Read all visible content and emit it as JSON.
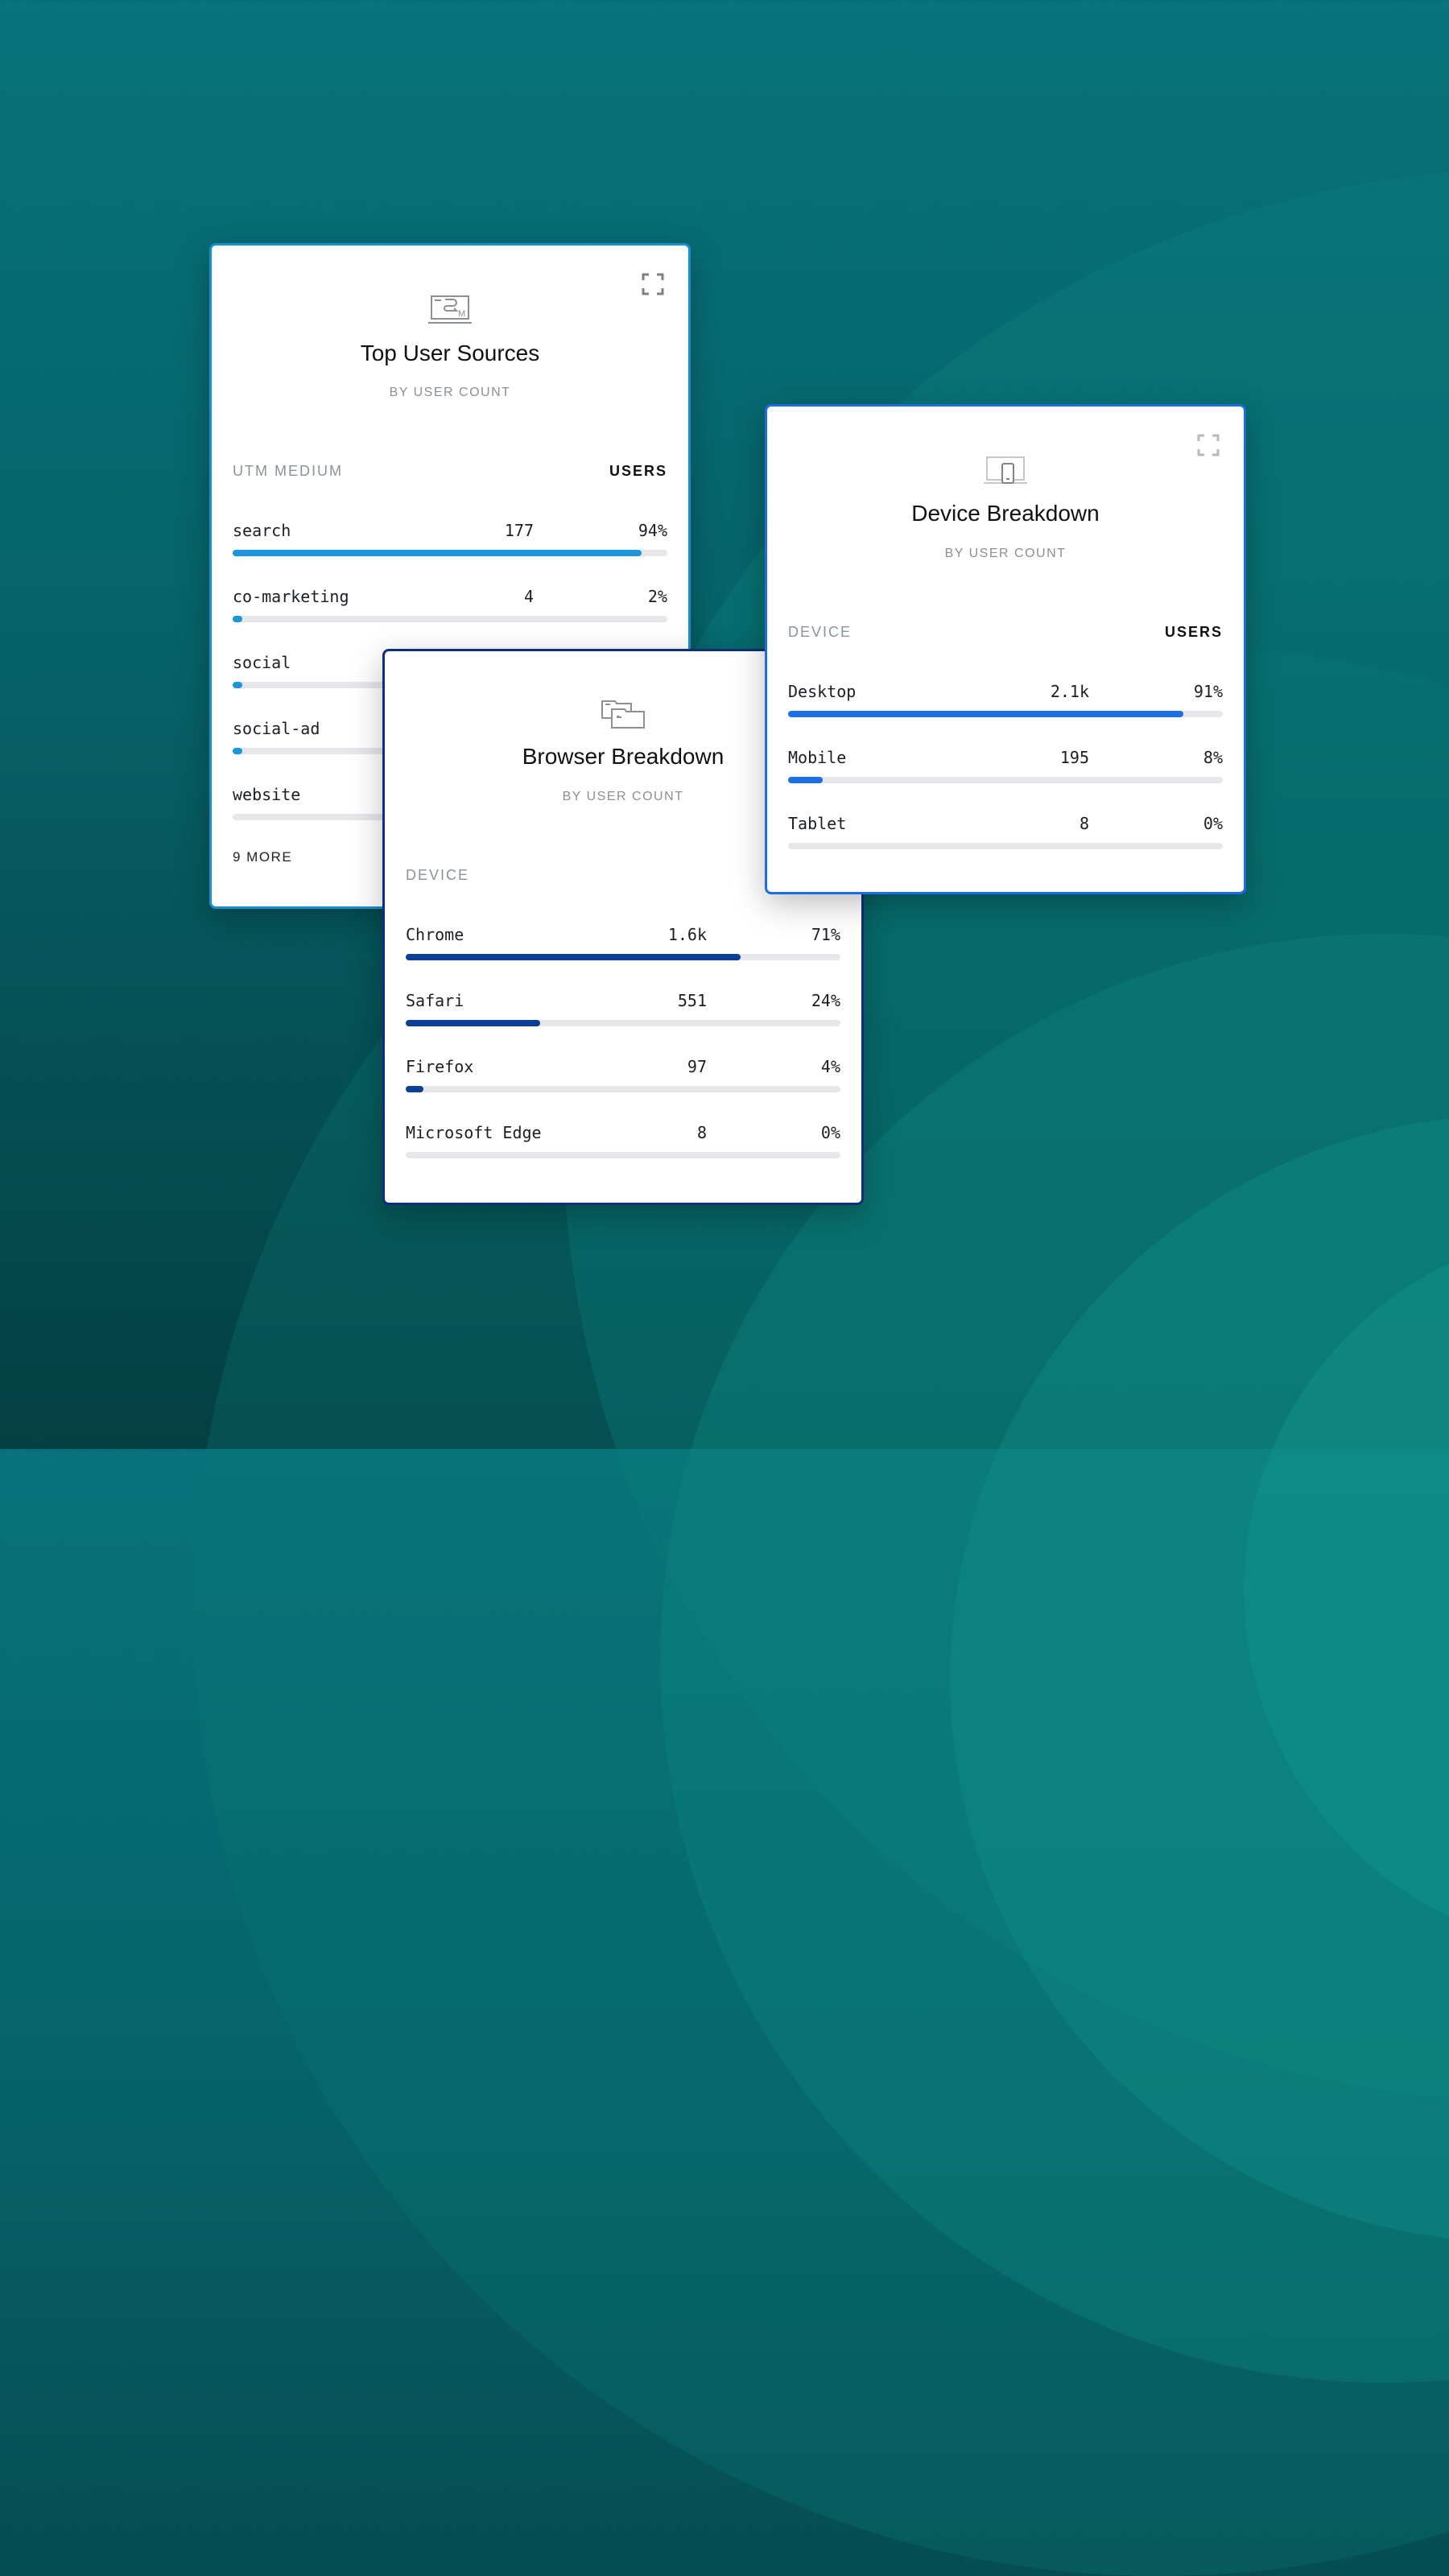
{
  "colors": {
    "sources_accent": "#1a96dc",
    "browser_accent": "#0d3f96",
    "device_accent": "#1d6fe6"
  },
  "cards": {
    "sources": {
      "icon": "utm-laptop-icon",
      "title": "Top User Sources",
      "subtitle": "BY USER COUNT",
      "col_left": "UTM MEDIUM",
      "col_right": "USERS",
      "rows": [
        {
          "name": "search",
          "count": "177",
          "pct": "94%",
          "fraction": 0.94
        },
        {
          "name": "co-marketing",
          "count": "4",
          "pct": "2%",
          "fraction": 0.02
        },
        {
          "name": "social",
          "count": "",
          "pct": "",
          "fraction": 0.01
        },
        {
          "name": "social-ad",
          "count": "",
          "pct": "",
          "fraction": 0.01
        },
        {
          "name": "website",
          "count": "",
          "pct": "",
          "fraction": 0
        }
      ],
      "more_label": "9 MORE"
    },
    "browser": {
      "icon": "browser-windows-icon",
      "title": "Browser Breakdown",
      "subtitle": "BY USER COUNT",
      "col_left": "DEVICE",
      "col_right": "",
      "rows": [
        {
          "name": "Chrome",
          "count": "1.6k",
          "pct": "71%",
          "fraction": 0.77
        },
        {
          "name": "Safari",
          "count": "551",
          "pct": "24%",
          "fraction": 0.31
        },
        {
          "name": "Firefox",
          "count": "97",
          "pct": "4%",
          "fraction": 0.04
        },
        {
          "name": "Microsoft Edge",
          "count": "8",
          "pct": "0%",
          "fraction": 0
        }
      ]
    },
    "device": {
      "icon": "device-laptop-phone-icon",
      "title": "Device Breakdown",
      "subtitle": "BY USER COUNT",
      "col_left": "DEVICE",
      "col_right": "USERS",
      "rows": [
        {
          "name": "Desktop",
          "count": "2.1k",
          "pct": "91%",
          "fraction": 0.91
        },
        {
          "name": "Mobile",
          "count": "195",
          "pct": "8%",
          "fraction": 0.08
        },
        {
          "name": "Tablet",
          "count": "8",
          "pct": "0%",
          "fraction": 0
        }
      ]
    }
  }
}
